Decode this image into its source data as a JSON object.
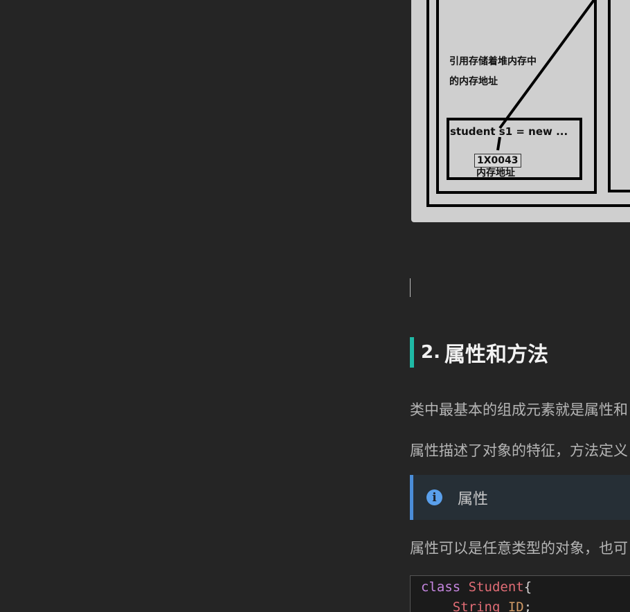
{
  "diagram": {
    "label_line1": "引用存储着堆内存中",
    "label_line2": "的内存地址",
    "code_label": "student s1 = new ...",
    "address": "1X0043",
    "address_caption": "内存地址"
  },
  "heading": {
    "number": "2.",
    "title": "属性和方法"
  },
  "paragraphs": {
    "p1": "类中最基本的组成元素就是属性和",
    "p2": "属性描述了对象的特征，方法定义"
  },
  "note": {
    "icon": "info-icon",
    "title": "属性"
  },
  "note_paragraph": "属性可以是任意类型的对象，也可",
  "code": {
    "line1_keyword": "class",
    "line1_name": "Student",
    "line1_brace": "{",
    "line2_type": "String",
    "line2_ident": "ID",
    "line2_semicolon": ";"
  },
  "colors": {
    "heading_accent": "#1fb9a5",
    "note_accent": "#4a8dd8",
    "background": "#252525"
  }
}
